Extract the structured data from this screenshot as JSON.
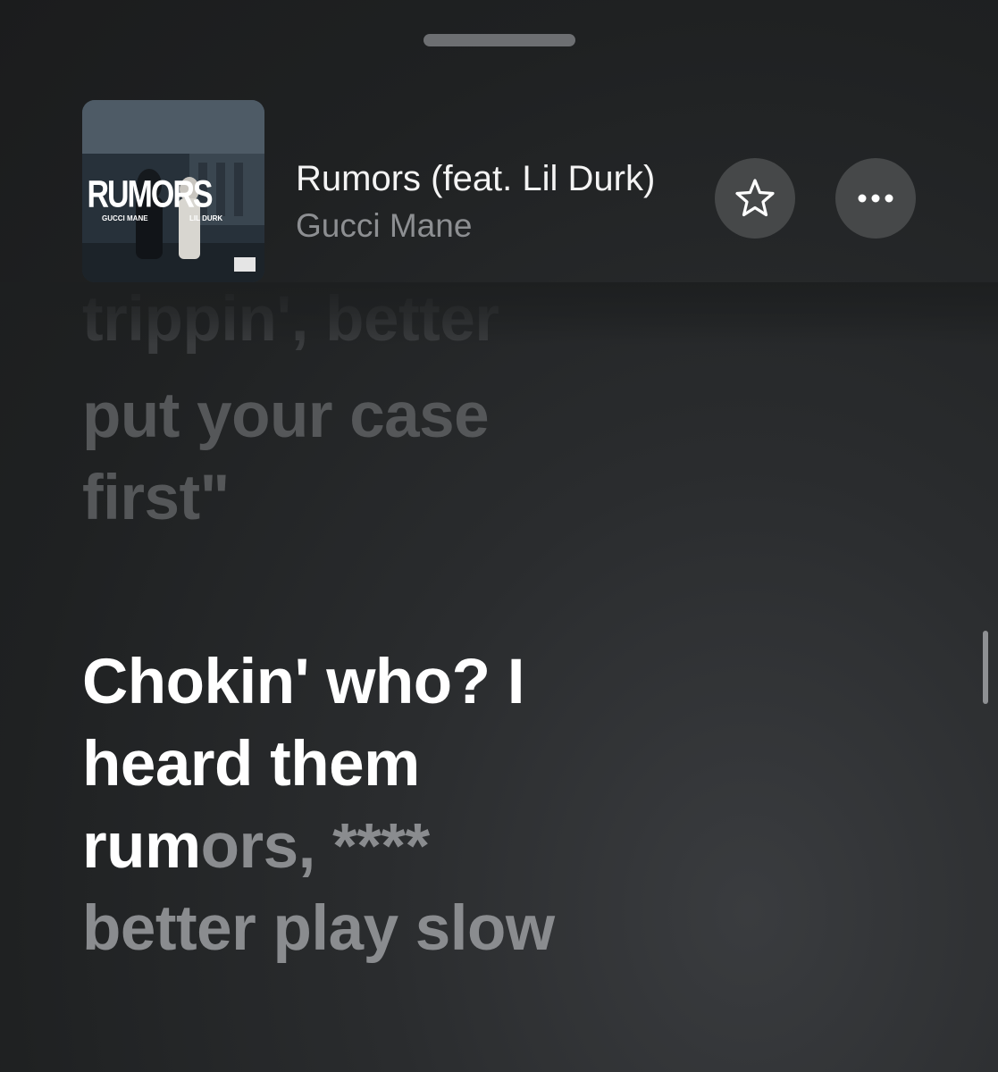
{
  "now_playing": {
    "title": "Rumors (feat. Lil Durk)",
    "artist": "Gucci Mane",
    "artwork": {
      "title": "RUMORS",
      "left_name": "GUCCI MANE",
      "right_name": "LIL DURK"
    }
  },
  "buttons": {
    "favorite_icon": "star-icon",
    "more_icon": "ellipsis-icon",
    "more_label": "•••"
  },
  "lyrics": {
    "previous_partial": "trippin', better",
    "previous_lines": [
      "put your case",
      "first\""
    ],
    "active_lines": [
      "Chokin' who? I",
      "heard them"
    ],
    "active_partial_sung": "rum",
    "active_partial_unsung": "ors, ****",
    "next_line": "better play slow"
  },
  "colors": {
    "background": "#1f2122",
    "active_lyric": "#ffffff",
    "inactive_lyric": "#555759",
    "button_bg": "#464849"
  }
}
